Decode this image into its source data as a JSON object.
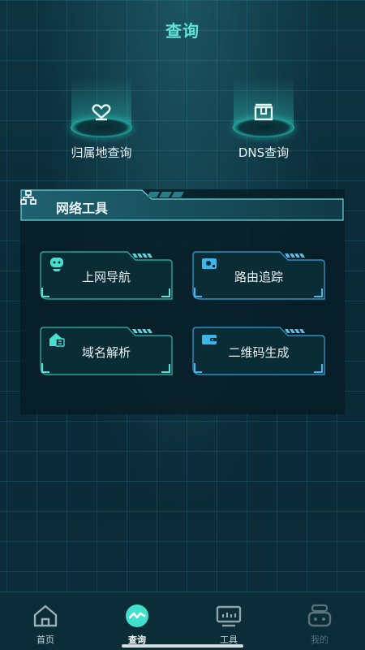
{
  "header": {
    "title": "查询"
  },
  "quick_actions": [
    {
      "label": "归属地查询",
      "icon": "location-heart-icon"
    },
    {
      "label": "DNS查询",
      "icon": "server-icon"
    }
  ],
  "panel": {
    "title": "网络工具",
    "icon": "network-icon",
    "tools": [
      {
        "label": "上网导航",
        "icon": "robot-icon"
      },
      {
        "label": "路由追踪",
        "icon": "router-icon"
      },
      {
        "label": "域名解析",
        "icon": "home-domain-icon"
      },
      {
        "label": "二维码生成",
        "icon": "wallet-icon"
      }
    ]
  },
  "tabbar": {
    "items": [
      {
        "label": "首页",
        "icon": "home-icon"
      },
      {
        "label": "查询",
        "icon": "pulse-icon"
      },
      {
        "label": "工具",
        "icon": "toolbox-icon"
      },
      {
        "label": "我的",
        "icon": "robot-face-icon"
      }
    ]
  },
  "colors": {
    "accent": "#2ee3d2",
    "background": "#0b2a35",
    "tool_accent": "#3db4ea"
  }
}
